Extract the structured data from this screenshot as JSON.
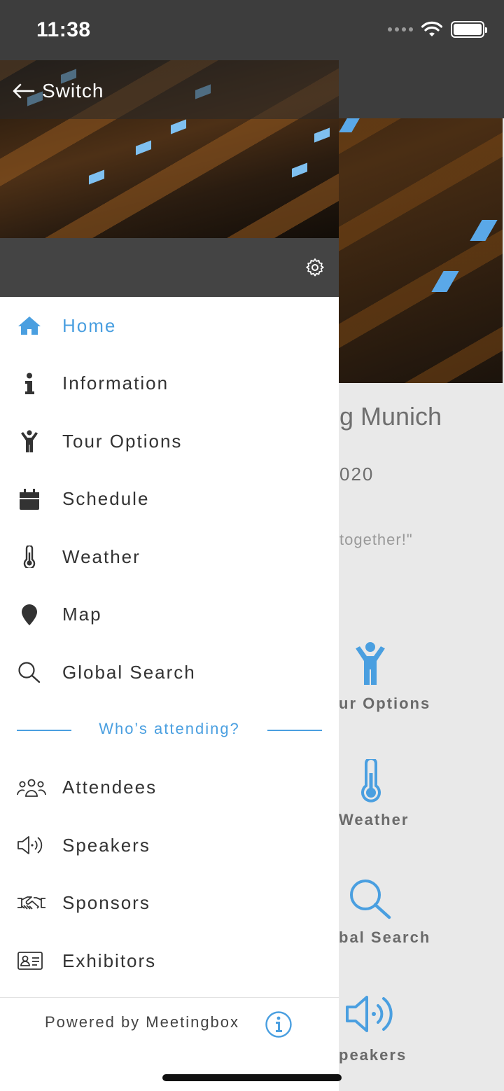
{
  "status_bar": {
    "time": "11:38"
  },
  "background": {
    "event_title_partial": "g Munich",
    "date_partial": "020",
    "quote_partial": "together!\"",
    "tiles": [
      {
        "label": "ur Options",
        "icon": "person-arms-up-icon"
      },
      {
        "label": "Weather",
        "icon": "thermometer-icon"
      },
      {
        "label": "bal Search",
        "icon": "search-icon"
      },
      {
        "label": "peakers",
        "icon": "speaker-icon"
      }
    ]
  },
  "drawer": {
    "switch_label": "Switch",
    "menu": [
      {
        "label": "Home",
        "icon": "home-icon",
        "active": true
      },
      {
        "label": "Information",
        "icon": "info-icon"
      },
      {
        "label": "Tour Options",
        "icon": "person-arms-up-icon"
      },
      {
        "label": "Schedule",
        "icon": "calendar-icon"
      },
      {
        "label": "Weather",
        "icon": "thermometer-icon"
      },
      {
        "label": "Map",
        "icon": "map-pin-icon"
      },
      {
        "label": "Global Search",
        "icon": "search-icon"
      }
    ],
    "section_label": "Who’s attending?",
    "attend_menu": [
      {
        "label": "Attendees",
        "icon": "people-icon"
      },
      {
        "label": "Speakers",
        "icon": "speaker-icon"
      },
      {
        "label": "Sponsors",
        "icon": "handshake-icon"
      },
      {
        "label": "Exhibitors",
        "icon": "id-card-icon"
      }
    ],
    "footer": "Powered by Meetingbox"
  },
  "colors": {
    "accent": "#4a9fe0",
    "bar": "#3d3d3d",
    "text": "#333333"
  }
}
